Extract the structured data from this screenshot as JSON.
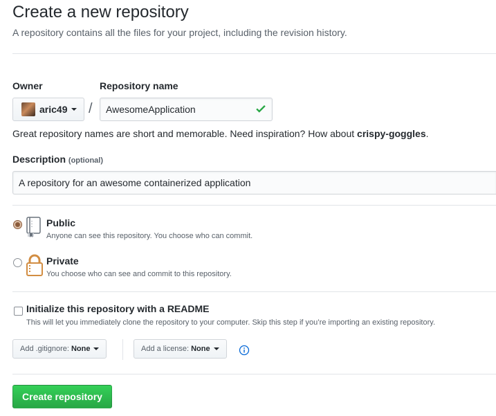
{
  "header": {
    "title": "Create a new repository",
    "subtitle": "A repository contains all the files for your project, including the revision history."
  },
  "owner": {
    "label": "Owner",
    "value": "aric49"
  },
  "repo": {
    "separator": "/",
    "label": "Repository name",
    "value": "AwesomeApplication",
    "valid": true,
    "hint_prefix": "Great repository names are short and memorable. Need inspiration? How about ",
    "hint_suggestion": "crispy-goggles",
    "hint_suffix": "."
  },
  "description": {
    "label": "Description",
    "optional": "(optional)",
    "value": "A repository for an awesome containerized application"
  },
  "visibility": {
    "selected": "public",
    "options": [
      {
        "title": "Public",
        "note": "Anyone can see this repository. You choose who can commit.",
        "icon": "repo-book-icon"
      },
      {
        "title": "Private",
        "note": "You choose who can see and commit to this repository.",
        "icon": "lock-icon"
      }
    ]
  },
  "init": {
    "checked": false,
    "title": "Initialize this repository with a README",
    "note": "This will let you immediately clone the repository to your computer. Skip this step if you’re importing an existing repository."
  },
  "gitignore": {
    "label": "Add .gitignore:",
    "value": "None"
  },
  "license": {
    "label": "Add a license:",
    "value": "None"
  },
  "submit": {
    "label": "Create repository"
  },
  "colors": {
    "primary_button": "#28a745",
    "valid_check": "#28a745",
    "border": "#e1e4e8"
  }
}
